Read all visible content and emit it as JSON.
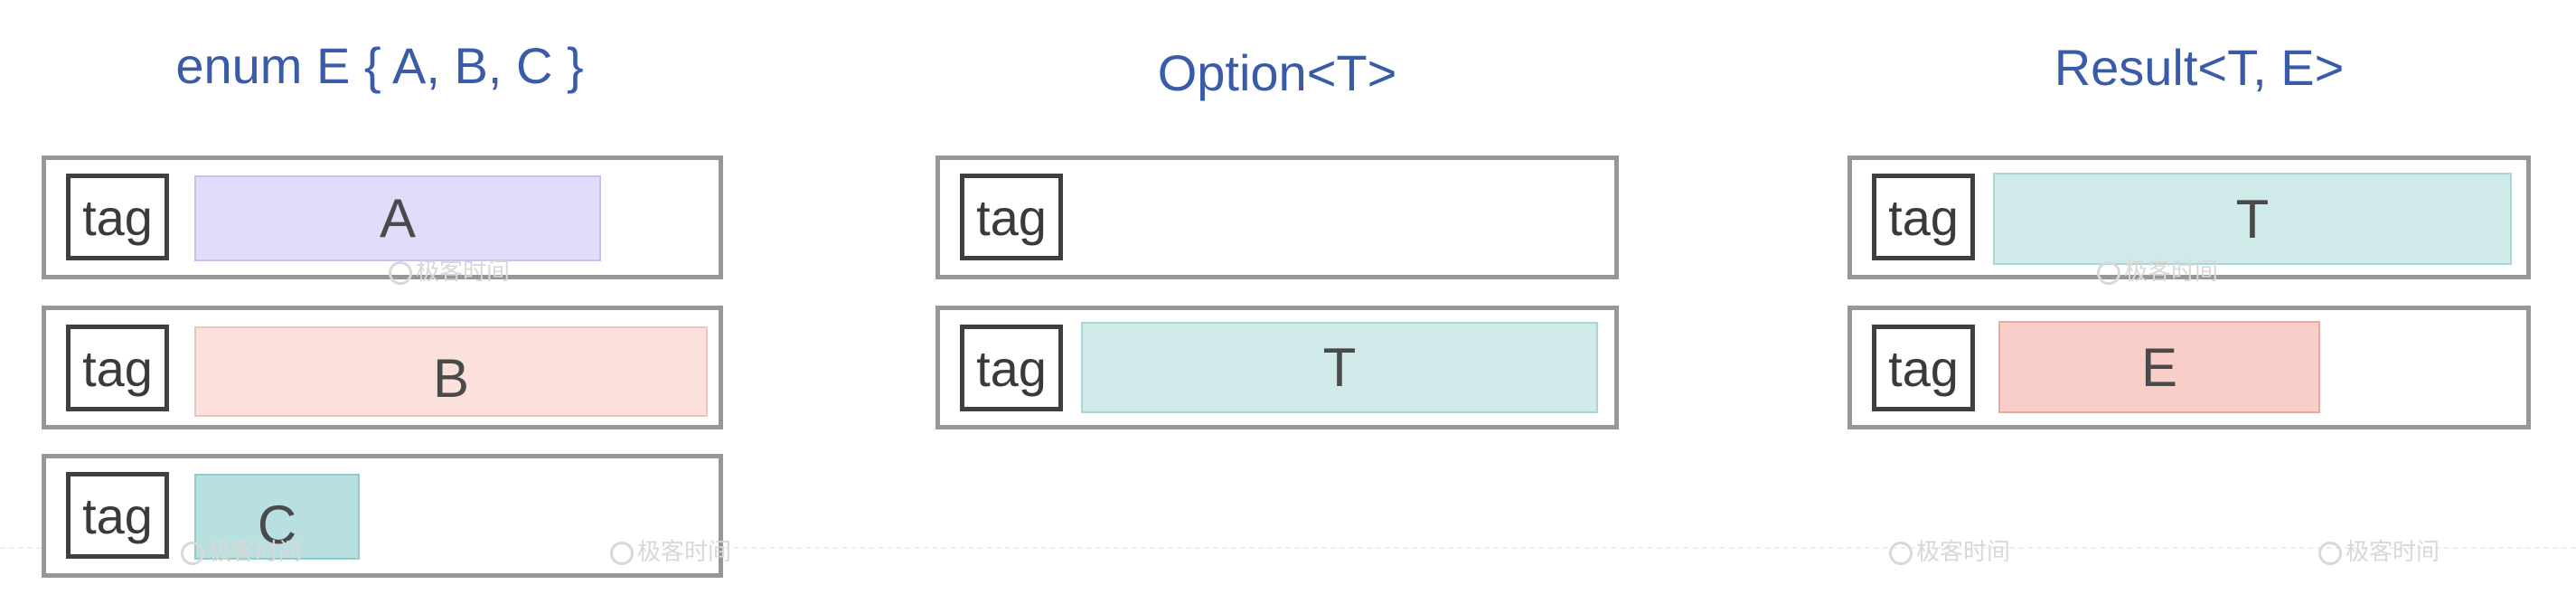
{
  "titles": {
    "enum": "enum E { A, B, C }",
    "option": "Option<T>",
    "result": "Result<T, E>"
  },
  "tag_label": "tag",
  "enum_rows": [
    {
      "variant": "A",
      "color": "#e2dcfb",
      "border": "#c9c0ef"
    },
    {
      "variant": "B",
      "color": "#fce0dc",
      "border": "#f0c4be"
    },
    {
      "variant": "C",
      "color": "#b9e0e0",
      "border": "#93c9c9"
    }
  ],
  "option_rows": [
    {
      "variant": ""
    },
    {
      "variant": "T",
      "color": "#d0eaea",
      "border": "#a9d5d5"
    }
  ],
  "result_rows": [
    {
      "variant": "T",
      "color": "#d0eaea",
      "border": "#a9d5d5"
    },
    {
      "variant": "E",
      "color": "#f9cec8",
      "border": "#eaa9a0"
    }
  ],
  "watermark": "极客时间"
}
